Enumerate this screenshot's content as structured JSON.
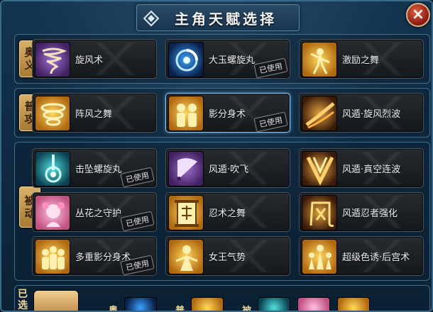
{
  "title": "主角天赋选择",
  "close_label": "×",
  "sections": {
    "ougi": {
      "tag_chars": [
        "奥",
        "义"
      ]
    },
    "normal": {
      "tag_chars": [
        "普",
        "攻"
      ]
    },
    "passive": {
      "tag_chars": [
        "被",
        "动"
      ]
    },
    "chosen": {
      "tag_chars": [
        "已",
        "选"
      ]
    }
  },
  "used_label": "已使用",
  "skills": {
    "ougi": [
      {
        "name": "旋风术",
        "icon": "tornado-icon",
        "used": false,
        "selected": false
      },
      {
        "name": "大玉螺旋丸",
        "icon": "rasengan-icon",
        "used": true,
        "selected": false
      },
      {
        "name": "激励之舞",
        "icon": "dance-icon",
        "used": false,
        "selected": false
      }
    ],
    "normal": [
      {
        "name": "阵风之舞",
        "icon": "gust-icon",
        "used": false,
        "selected": false
      },
      {
        "name": "影分身术",
        "icon": "shadow-clone-icon",
        "used": true,
        "selected": true
      },
      {
        "name": "风遁·旋风烈波",
        "icon": "wind-wave-icon",
        "used": false,
        "selected": false
      }
    ],
    "passive": [
      {
        "name": "击坠螺旋丸",
        "icon": "falling-rasengan-icon",
        "used": true,
        "selected": false
      },
      {
        "name": "风遁·吹飞",
        "icon": "fan-icon",
        "used": false,
        "selected": false
      },
      {
        "name": "风遁·真空连波",
        "icon": "vacuum-wave-icon",
        "used": false,
        "selected": false
      },
      {
        "name": "丛花之守护",
        "icon": "flower-guard-icon",
        "used": true,
        "selected": false
      },
      {
        "name": "忍术之舞",
        "icon": "ninja-scroll-icon",
        "used": false,
        "selected": false
      },
      {
        "name": "风遁忍者强化",
        "icon": "wind-kanji-icon",
        "used": false,
        "selected": false
      },
      {
        "name": "多重影分身术",
        "icon": "multi-clone-icon",
        "used": true,
        "selected": false
      },
      {
        "name": "女王气势",
        "icon": "queen-icon",
        "used": false,
        "selected": false
      },
      {
        "name": "超级色诱·后宫术",
        "icon": "harem-icon",
        "used": false,
        "selected": false
      }
    ]
  },
  "chosen": {
    "ougi_label": "奥",
    "normal_label": "普",
    "passive_label": "被"
  }
}
